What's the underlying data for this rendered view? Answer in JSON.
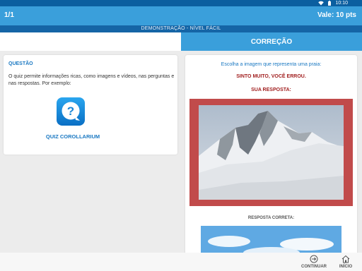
{
  "status_bar": {
    "time": "10:10"
  },
  "header": {
    "progress": "1/1",
    "points": "Vale: 10 pts"
  },
  "subtitle": "DEMONSTRAÇÃO - NÍVEL FÁCIL",
  "correction_header": "CORREÇÃO",
  "question": {
    "title": "QUESTÃO",
    "text": "O quiz permite informações ricas, como imagens e vídeos, nas perguntas e nas respostas. Por exemplo:",
    "app_name": "QUIZ COROLLARIUM"
  },
  "correction": {
    "prompt": "Escolha a imagem que representa uma praia:",
    "result": "SINTO MUITO, VOCÊ ERROU.",
    "your_answer_label": "SUA RESPOSTA:",
    "correct_answer_label": "RESPOSTA CORRETA:"
  },
  "bottom_nav": {
    "continue_label": "CONTINUAR",
    "home_label": "INÍCIO"
  },
  "colors": {
    "accent_blue": "#3a9fdb",
    "dark_blue": "#1565a6",
    "error_red": "#a11f1f",
    "wrong_frame": "#c14b4b"
  },
  "icons": [
    "wifi-icon",
    "battery-icon",
    "app-logo-icon",
    "continue-icon",
    "home-icon"
  ]
}
